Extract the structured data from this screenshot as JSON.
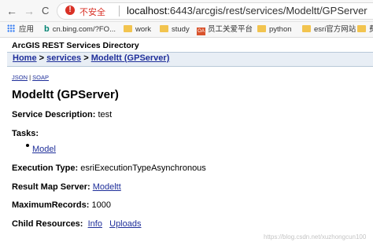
{
  "browser": {
    "back_icon": "←",
    "forward_icon": "→",
    "reload_icon": "C",
    "security_icon": "!",
    "security_label": "不安全",
    "url_host": "localhost",
    "url_rest": ":6443/arcgis/rest/services/Modeltt/GPServer"
  },
  "bookmarks": {
    "apps": "应用",
    "bing": "cn.bing.com/?FO...",
    "work": "work",
    "study": "study",
    "staff": "员工关爱平台",
    "python": "python",
    "esri": "esri官方网站",
    "extra": "费"
  },
  "page": {
    "directory_title": "ArcGIS REST Services Directory",
    "crumb_home": "Home",
    "crumb_services": "services",
    "crumb_current": "Modeltt (GPServer)",
    "crumb_sep": ">",
    "fmt_json": "JSON",
    "fmt_sep": "|",
    "fmt_soap": "SOAP",
    "heading": "Modeltt (GPServer)",
    "service_description_label": "Service Description:",
    "service_description_value": "test",
    "tasks_label": "Tasks:",
    "task_model": "Model",
    "execution_type_label": "Execution Type:",
    "execution_type_value": "esriExecutionTypeAsynchronous",
    "result_map_server_label": "Result Map Server:",
    "result_map_server_link": "Modeltt",
    "max_records_label": "MaximumRecords:",
    "max_records_value": "1000",
    "child_resources_label": "Child Resources:",
    "child_info": "Info",
    "child_uploads": "Uploads"
  },
  "watermark": "https://blog.csdn.net/xuzhongcun100"
}
